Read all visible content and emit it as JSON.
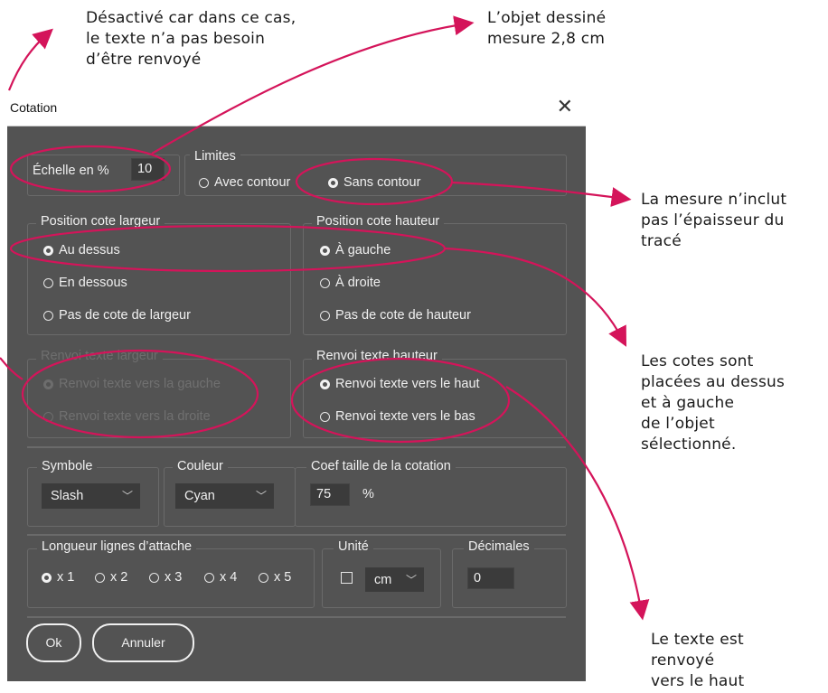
{
  "annotations": {
    "a1": [
      "Désactivé car dans ce cas,",
      "le texte n’a pas besoin",
      "d’être renvoyé"
    ],
    "a2": [
      "L’objet dessiné",
      "mesure 2,8 cm"
    ],
    "a3": [
      "La mesure n’inclut",
      "pas l’épaisseur du",
      "tracé"
    ],
    "a4": [
      "Les cotes sont",
      "placées au dessus",
      "et à gauche",
      "de l’objet",
      "sélectionné."
    ],
    "a5": [
      "Le texte est",
      "renvoyé",
      "vers le haut"
    ]
  },
  "dialog": {
    "title": "Cotation",
    "scale_label": "Échelle en %",
    "scale_value": "10",
    "limits": {
      "label": "Limites",
      "opt1": "Avec contour",
      "opt2": "Sans contour"
    },
    "width_pos": {
      "label": "Position cote largeur",
      "o1": "Au dessus",
      "o2": "En dessous",
      "o3": "Pas de cote de largeur"
    },
    "height_pos": {
      "label": "Position cote hauteur",
      "o1": "À gauche",
      "o2": "À droite",
      "o3": "Pas de cote de hauteur"
    },
    "width_text": {
      "label": "Renvoi texte largeur",
      "o1": "Renvoi texte vers la gauche",
      "o2": "Renvoi texte vers la droite"
    },
    "height_text": {
      "label": "Renvoi texte hauteur",
      "o1": "Renvoi texte vers le haut",
      "o2": "Renvoi texte vers le bas"
    },
    "symbol": {
      "label": "Symbole",
      "value": "Slash"
    },
    "color": {
      "label": "Couleur",
      "value": "Cyan"
    },
    "coef": {
      "label": "Coef taille de la cotation",
      "value": "75",
      "unit": "%"
    },
    "lines": {
      "label": "Longueur lignes d’attache",
      "o1": "x 1",
      "o2": "x 2",
      "o3": "x 3",
      "o4": "x 4",
      "o5": "x 5"
    },
    "unit": {
      "label": "Unité",
      "value": "cm"
    },
    "decimals": {
      "label": "Décimales",
      "value": "0"
    },
    "ok": "Ok",
    "cancel": "Annuler"
  },
  "colors": {
    "annotation": "#d4145a",
    "dialog_bg": "#535353",
    "field_bg": "#3b3b3b"
  }
}
